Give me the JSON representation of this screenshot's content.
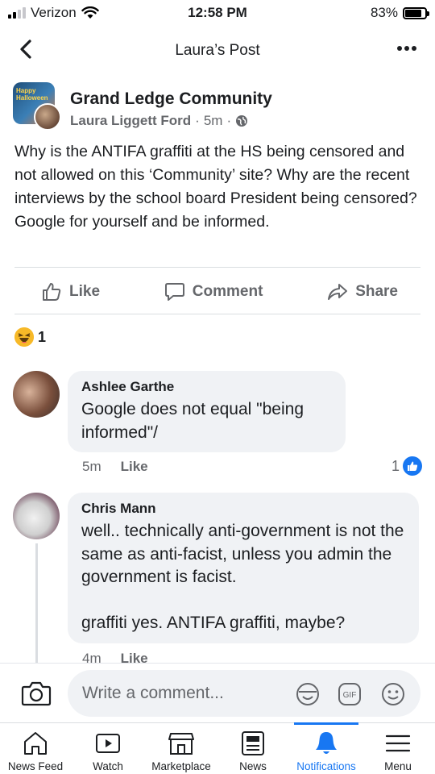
{
  "status_bar": {
    "carrier": "Verizon",
    "time": "12:58 PM",
    "battery": "83%",
    "battery_level": 0.83
  },
  "header": {
    "title": "Laura’s Post"
  },
  "post": {
    "group_name": "Grand Ledge Community",
    "group_avatar_text": "Happy Halloween",
    "author": "Laura Liggett Ford",
    "time": "5m",
    "separator": "·",
    "text": "Why is the ANTIFA graffiti at the HS being censored and not allowed on this ‘Community’ site?  Why are the recent interviews by the school board President being censored?  Google for yourself and be informed.",
    "actions": {
      "like": "Like",
      "comment": "Comment",
      "share": "Share"
    },
    "reaction_count": "1"
  },
  "comments": [
    {
      "name": "Ashlee Garthe",
      "text": "Google does not equal \"being informed\"/",
      "time": "5m",
      "like_label": "Like",
      "likes": "1"
    },
    {
      "name": "Chris Mann",
      "text": "well.. technically anti-government is not the same as anti-facist, unless you admin the government is facist.\n\ngraffiti yes. ANTIFA graffiti, maybe?",
      "time": "4m",
      "like_label": "Like"
    }
  ],
  "composer": {
    "placeholder": "Write a comment..."
  },
  "tabs": [
    {
      "label": "News Feed",
      "icon": "home-icon"
    },
    {
      "label": "Watch",
      "icon": "watch-icon"
    },
    {
      "label": "Marketplace",
      "icon": "marketplace-icon"
    },
    {
      "label": "News",
      "icon": "news-icon"
    },
    {
      "label": "Notifications",
      "icon": "bell-icon",
      "active": true
    },
    {
      "label": "Menu",
      "icon": "menu-icon"
    }
  ],
  "colors": {
    "accent": "#1877f2",
    "secondary_text": "#65676b",
    "bubble": "#f0f2f5"
  }
}
